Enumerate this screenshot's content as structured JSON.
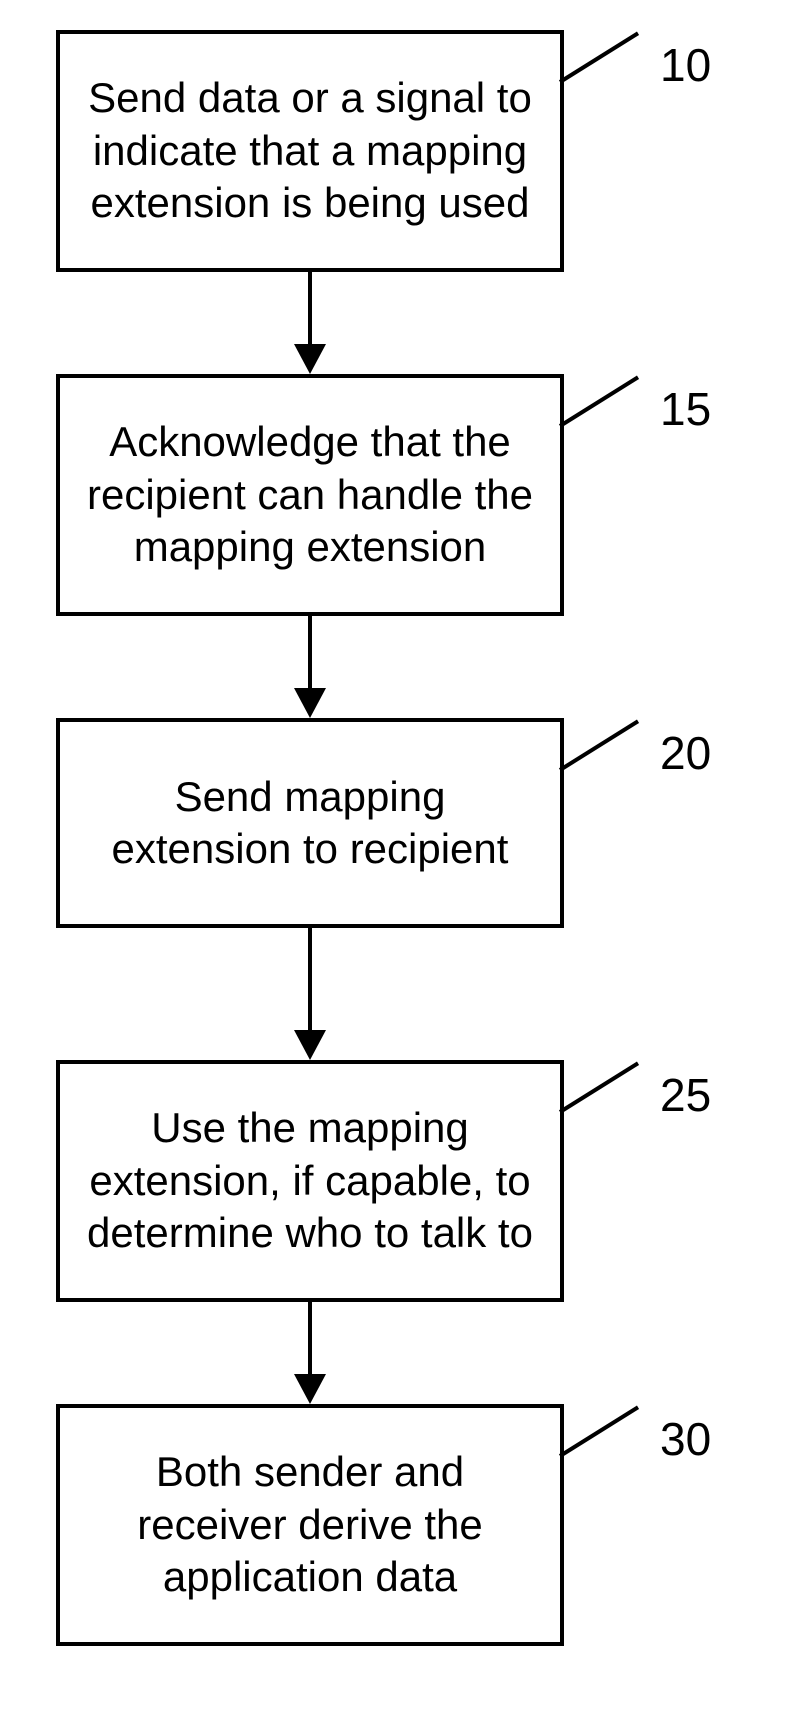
{
  "nodes": [
    {
      "id": "n10",
      "label": "10",
      "text": "Send data or a signal to indicate that a mapping extension is being used"
    },
    {
      "id": "n15",
      "label": "15",
      "text": "Acknowledge that the recipient can handle the mapping extension"
    },
    {
      "id": "n20",
      "label": "20",
      "text": "Send mapping extension to recipient"
    },
    {
      "id": "n25",
      "label": "25",
      "text": "Use the mapping extension, if capable, to determine who to talk to"
    },
    {
      "id": "n30",
      "label": "30",
      "text": "Both sender and receiver derive the application data"
    }
  ]
}
